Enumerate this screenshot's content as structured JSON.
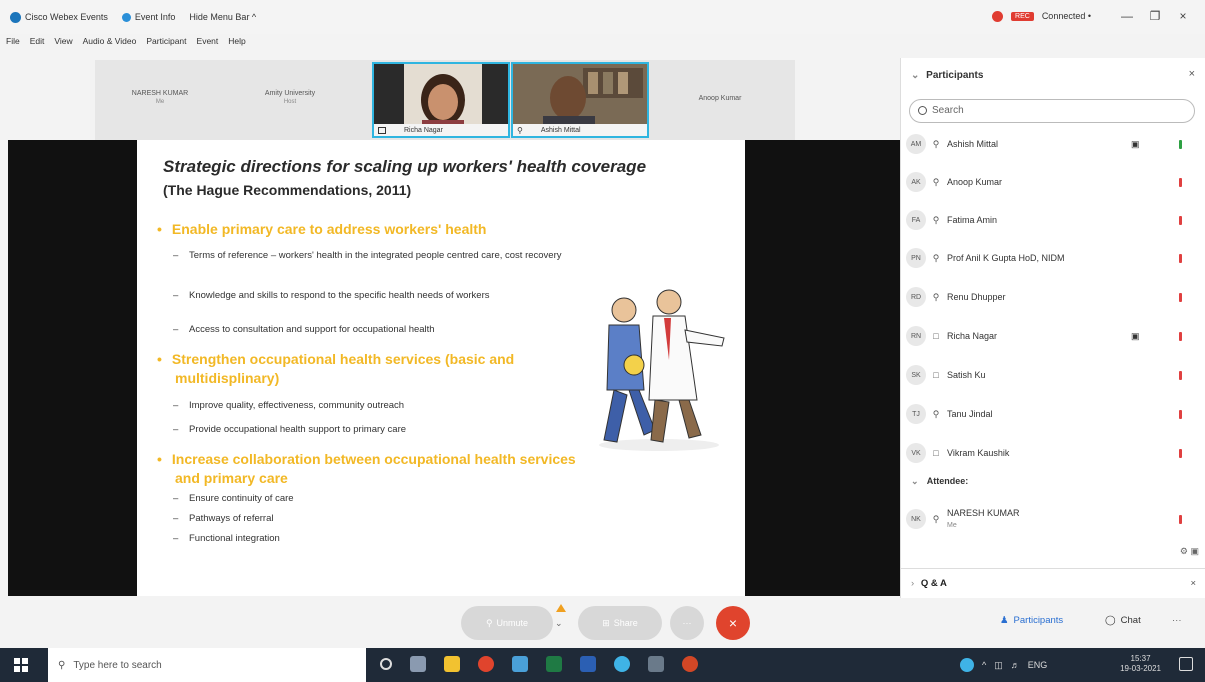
{
  "titlebar": {
    "app_name": "Cisco Webex Events",
    "event_info": "Event Info",
    "hide_menu": "Hide Menu Bar ^",
    "connected": "Connected •",
    "rec_label": "REC",
    "minimize": "—",
    "restore": "❐",
    "close": "×"
  },
  "menubar": [
    "File",
    "Edit",
    "View",
    "Audio & Video",
    "Participant",
    "Event",
    "Help"
  ],
  "strip": {
    "names": [
      {
        "name": "NARESH KUMAR",
        "role": "Me"
      },
      {
        "name": "Amity University",
        "role": "Host"
      },
      {
        "name": "Anoop Kumar",
        "role": ""
      }
    ],
    "tiles": [
      {
        "label": "Richa Nagar"
      },
      {
        "label": "Ashish Mittal"
      }
    ]
  },
  "slide": {
    "title": "Strategic directions for scaling up workers' health coverage",
    "subtitle": "(The Hague Recommendations, 2011)",
    "bullet1": "Enable primary care to address workers' health",
    "b1_items": [
      "Terms of reference – workers' health in the integrated people centred care, cost recovery",
      "Knowledge and skills to respond to the specific health needs of workers",
      "Access to consultation and support for occupational health"
    ],
    "bullet2": "Strengthen occupational health services (basic and multidisplinary)",
    "b2_items": [
      "Improve quality, effectiveness, community outreach",
      "Provide occupational health support to primary care"
    ],
    "bullet3": "Increase collaboration between occupational health services and primary care",
    "b3_items": [
      "Ensure continuity of care",
      "Pathways of referral",
      "Functional integration"
    ]
  },
  "panel": {
    "title": "Participants",
    "search_placeholder": "Search",
    "participants": [
      {
        "initials": "AM",
        "name": "Ashish Mittal",
        "camera": true,
        "muted": false
      },
      {
        "initials": "AK",
        "name": "Anoop Kumar",
        "camera": false,
        "muted": true
      },
      {
        "initials": "FA",
        "name": "Fatima Amin",
        "camera": false,
        "muted": true
      },
      {
        "initials": "PN",
        "name": "Prof Anil K Gupta HoD, NIDM",
        "camera": false,
        "muted": true
      },
      {
        "initials": "RD",
        "name": "Renu Dhupper",
        "camera": false,
        "muted": true
      },
      {
        "initials": "RN",
        "name": "Richa Nagar",
        "camera": true,
        "muted": true
      },
      {
        "initials": "SK",
        "name": "Satish Ku",
        "camera": false,
        "muted": true
      },
      {
        "initials": "TJ",
        "name": "Tanu Jindal",
        "camera": false,
        "muted": true
      },
      {
        "initials": "VK",
        "name": "Vikram Kaushik",
        "camera": false,
        "muted": true
      }
    ],
    "attendee_heading": "Attendee:",
    "attendee": {
      "initials": "NK",
      "name": "NARESH KUMAR",
      "sub": "Me"
    },
    "qa": "Q & A"
  },
  "controls": {
    "unmute": "Unmute",
    "share": "Share",
    "more": "···",
    "participants": "Participants",
    "chat": "Chat"
  },
  "taskbar": {
    "search_placeholder": "Type here to search",
    "lang": "ENG",
    "time": "15:37",
    "date": "19-03-2021"
  }
}
